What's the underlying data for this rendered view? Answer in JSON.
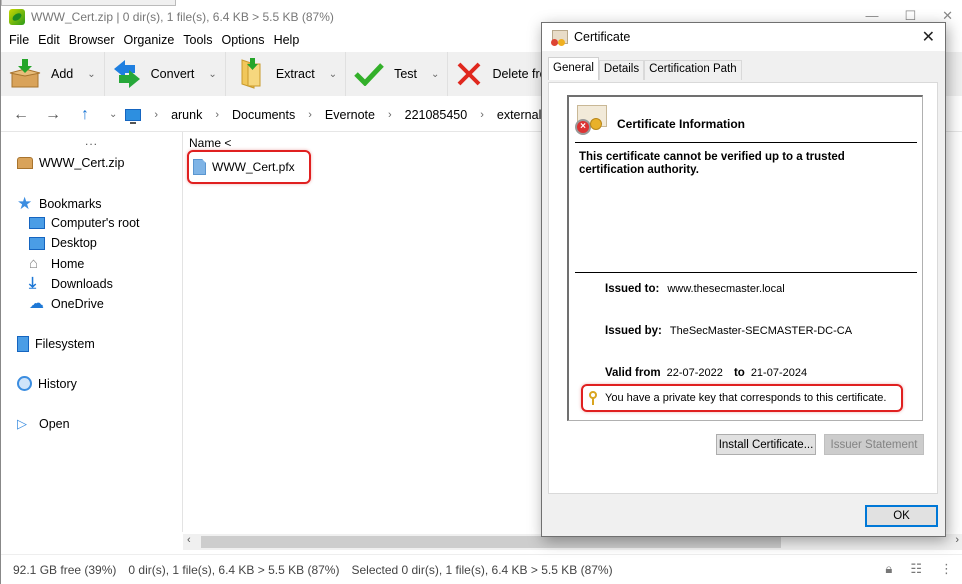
{
  "window": {
    "title": "WWW_Cert.zip | 0 dir(s), 1 file(s), 6.4 KB > 5.5 KB (87%)",
    "controls": [
      "minimize",
      "maximize",
      "close"
    ]
  },
  "menu": [
    "File",
    "Edit",
    "Browser",
    "Organize",
    "Tools",
    "Options",
    "Help"
  ],
  "toolbar": [
    {
      "label": "Add",
      "icon": "add-archive-icon"
    },
    {
      "label": "Convert",
      "icon": "convert-icon"
    },
    {
      "label": "Extract",
      "icon": "extract-icon"
    },
    {
      "label": "Test",
      "icon": "checkmark-icon"
    },
    {
      "label": "Delete from",
      "icon": "delete-icon"
    }
  ],
  "breadcrumb": [
    "arunk",
    "Documents",
    "Evernote",
    "221085450",
    "external-"
  ],
  "sidebar": {
    "more": "...",
    "archive": "WWW_Cert.zip",
    "bookmarks_label": "Bookmarks",
    "bookmarks": [
      "Computer's root",
      "Desktop",
      "Home",
      "Downloads",
      "OneDrive"
    ],
    "filesystem": "Filesystem",
    "history": "History",
    "open": "Open"
  },
  "filelist": {
    "column_header": "Name <",
    "files": [
      "WWW_Cert.pfx"
    ]
  },
  "status": {
    "free": "92.1 GB free (39%)",
    "summary": "0 dir(s), 1 file(s), 6.4 KB > 5.5 KB (87%)",
    "selected": "Selected 0 dir(s), 1 file(s), 6.4 KB > 5.5 KB (87%)"
  },
  "dialog": {
    "title": "Certificate",
    "tabs": [
      "General",
      "Details",
      "Certification Path"
    ],
    "active_tab": "General",
    "heading": "Certificate Information",
    "warning": "This certificate cannot be verified up to a trusted certification authority.",
    "issued_to_label": "Issued to:",
    "issued_to": "www.thesecmaster.local",
    "issued_by_label": "Issued by:",
    "issued_by": "TheSecMaster-SECMASTER-DC-CA",
    "valid_from_label": "Valid from",
    "valid_from": "22-07-2022",
    "valid_to_label": "to",
    "valid_to": "21-07-2024",
    "private_key_note": "You have a private key that corresponds to this certificate.",
    "install_button": "Install Certificate...",
    "issuer_button": "Issuer Statement",
    "ok_button": "OK"
  }
}
